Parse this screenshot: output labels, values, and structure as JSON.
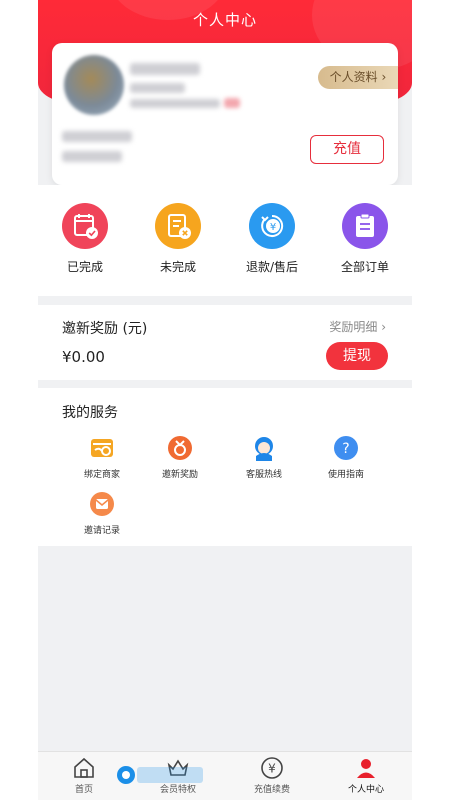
{
  "header": {
    "title": "个人中心"
  },
  "profile": {
    "profile_link_label": "个人资料",
    "recharge_label": "充值"
  },
  "orders": [
    {
      "label": "已完成",
      "icon": "calendar-check-icon",
      "color": "#f0445a"
    },
    {
      "label": "未完成",
      "icon": "document-cancel-icon",
      "color": "#f6a51e"
    },
    {
      "label": "退款/售后",
      "icon": "refund-yen-icon",
      "color": "#2a9af0"
    },
    {
      "label": "全部订单",
      "icon": "clipboard-icon",
      "color": "#8a55ea"
    }
  ],
  "reward": {
    "title": "邀新奖励 (元)",
    "detail_label": "奖励明细",
    "amount": "¥0.00",
    "withdraw_label": "提现"
  },
  "services": {
    "title": "我的服务",
    "items": [
      {
        "label": "绑定商家",
        "icon": "store-bind-icon"
      },
      {
        "label": "邀新奖励",
        "icon": "medal-icon"
      },
      {
        "label": "客服热线",
        "icon": "customer-service-icon"
      },
      {
        "label": "使用指南",
        "icon": "help-icon"
      },
      {
        "label": "邀请记录",
        "icon": "invite-mail-icon"
      }
    ]
  },
  "tabbar": {
    "items": [
      {
        "label": "首页",
        "icon": "home-icon"
      },
      {
        "label": "会员特权",
        "icon": "crown-icon"
      },
      {
        "label": "充值续费",
        "icon": "yen-circle-icon"
      },
      {
        "label": "个人中心",
        "icon": "person-icon",
        "active": true
      }
    ]
  },
  "colors": {
    "brand_red": "#f0263c",
    "accent_gold": "#d7bb8e"
  }
}
